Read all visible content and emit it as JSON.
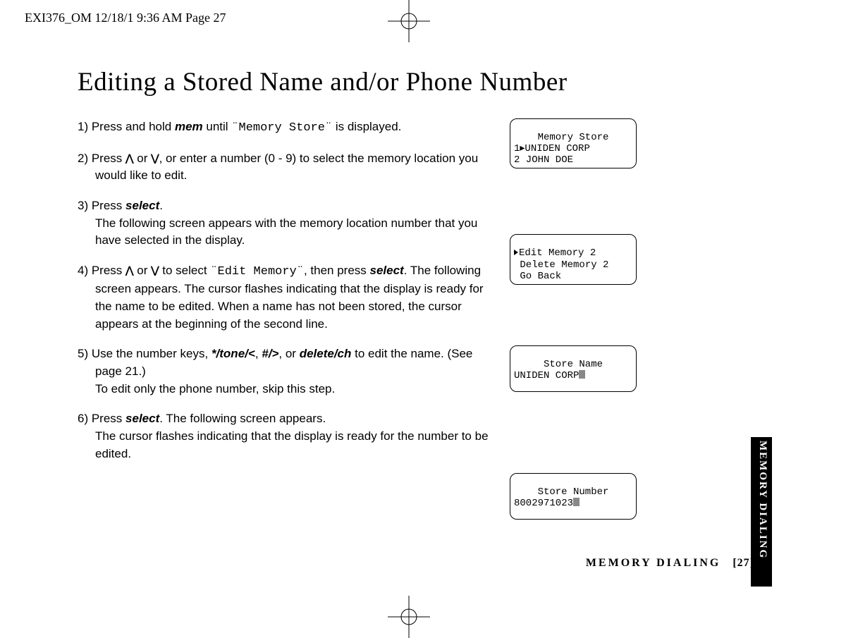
{
  "meta": {
    "header": "EXI376_OM  12/18/1 9:36 AM  Page 27"
  },
  "title": "Editing a Stored Name and/or Phone Number",
  "steps": {
    "s1_a": "1) Press and hold ",
    "s1_mem": "mem",
    "s1_b": " until ",
    "s1_lcd": "¨Memory Store¨",
    "s1_c": " is displayed.",
    "s2_a": "2) Press ",
    "s2_b": " or ",
    "s2_c": ", or enter a number (0 - 9) to select the memory location you would like to edit.",
    "s3_a": "3) Press ",
    "s3_sel": "select",
    "s3_b": ".",
    "s3_c": "The following screen appears with the memory location number that you have selected in the display.",
    "s4_a": "4) Press ",
    "s4_b": " or ",
    "s4_c": " to select ",
    "s4_lcd": "¨Edit Memory¨",
    "s4_d": ", then press ",
    "s4_sel": "select",
    "s4_e": ". The following screen appears. The cursor flashes indicating that the display is ready for the name to be edited. When a name has not been stored, the cursor appears at the beginning of the second line.",
    "s5_a": "5) Use the number keys, ",
    "s5_k1": "*/tone/",
    "s5_lt": "<",
    "s5_comma": ", ",
    "s5_k2": "#/",
    "s5_gt": ">",
    "s5_b": ", or ",
    "s5_k3": "delete/ch",
    "s5_c": " to edit the name. (See page 21.)",
    "s5_d": "To edit only the phone number, skip this step.",
    "s6_a": "6) Press ",
    "s6_sel": "select",
    "s6_b": ". The following screen appears.",
    "s6_c": "The cursor flashes indicating that the display is ready for the number to be edited."
  },
  "lcds": {
    "l1": {
      "title": "Memory Store",
      "line1": "1▸UNIDEN CORP",
      "line2": "2 JOHN DOE"
    },
    "l2": {
      "line1": "Edit Memory 2",
      "line2": " Delete Memory 2",
      "line3": " Go Back"
    },
    "l3": {
      "title": "Store Name",
      "line1": "UNIDEN CORP"
    },
    "l4": {
      "title": "Store Number",
      "line1": "8002971023"
    }
  },
  "footer": {
    "section": "MEMORY DIALING",
    "page_open": "[",
    "page_num": "27",
    "page_close": "]"
  },
  "side_tab": "MEMORY DIALING"
}
